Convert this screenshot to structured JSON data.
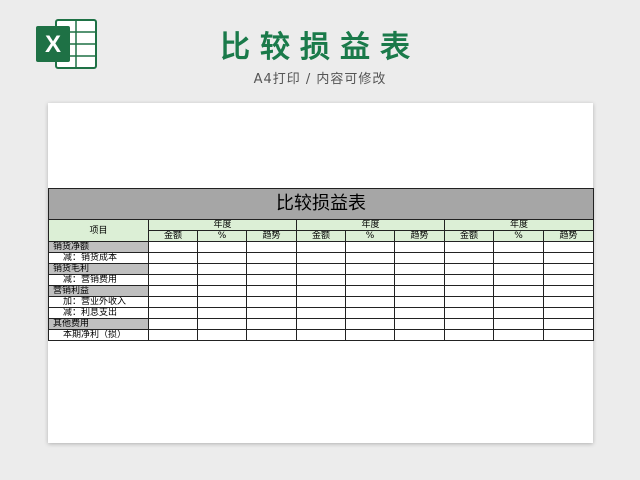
{
  "page": {
    "title": "比较损益表",
    "subtitle": "A4打印 / 内容可修改",
    "logo_letter": "X"
  },
  "colors": {
    "title_green": "#1a7a4a",
    "header_green": "#dcefd6",
    "title_band_gray": "#a6a6a6",
    "category_gray": "#bfbfbf"
  },
  "sheet": {
    "table_title": "比较损益表",
    "item_header": "项目",
    "year_groups": [
      "年度",
      "年度",
      "年度"
    ],
    "subheaders": [
      "金额",
      "%",
      "趋势"
    ],
    "rows": [
      {
        "label": "销货净额",
        "type": "category"
      },
      {
        "label": "减：销货成本",
        "type": "sub"
      },
      {
        "label": "销货毛利",
        "type": "category"
      },
      {
        "label": "减：营销费用",
        "type": "sub"
      },
      {
        "label": "营销利益",
        "type": "category"
      },
      {
        "label": "加：营业外收入",
        "type": "sub"
      },
      {
        "label": "减：利息支出",
        "type": "sub"
      },
      {
        "label": "其他费用",
        "type": "category"
      },
      {
        "label": "本期净利（损）",
        "type": "sub"
      }
    ]
  }
}
